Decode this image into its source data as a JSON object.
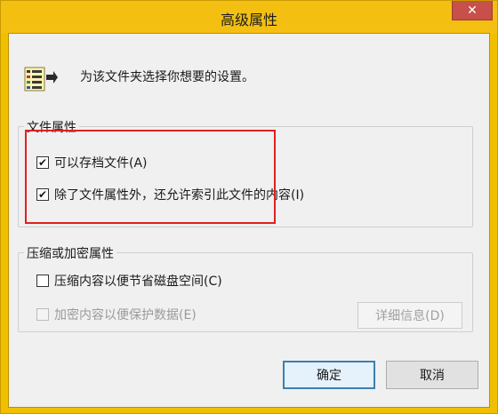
{
  "window": {
    "title": "高级属性",
    "close_label": "✕"
  },
  "header": {
    "intro": "为该文件夹选择你想要的设置。",
    "icon": "folder-properties-icon"
  },
  "file_attributes": {
    "title": "文件属性",
    "archive": {
      "label": "可以存档文件(A)",
      "checked": true
    },
    "index": {
      "label": "除了文件属性外，还允许索引此文件的内容(I)",
      "checked": true
    }
  },
  "compress_encrypt": {
    "title": "压缩或加密属性",
    "compress": {
      "label": "压缩内容以便节省磁盘空间(C)",
      "checked": false
    },
    "encrypt": {
      "label": "加密内容以便保护数据(E)",
      "checked": false,
      "enabled": false
    },
    "details_label": "详细信息(D)"
  },
  "buttons": {
    "ok": "确定",
    "cancel": "取消"
  },
  "colors": {
    "titlebar": "#f3c012",
    "close": "#c7504b",
    "highlight": "#e02020",
    "primary_border": "#3c7fb1"
  }
}
